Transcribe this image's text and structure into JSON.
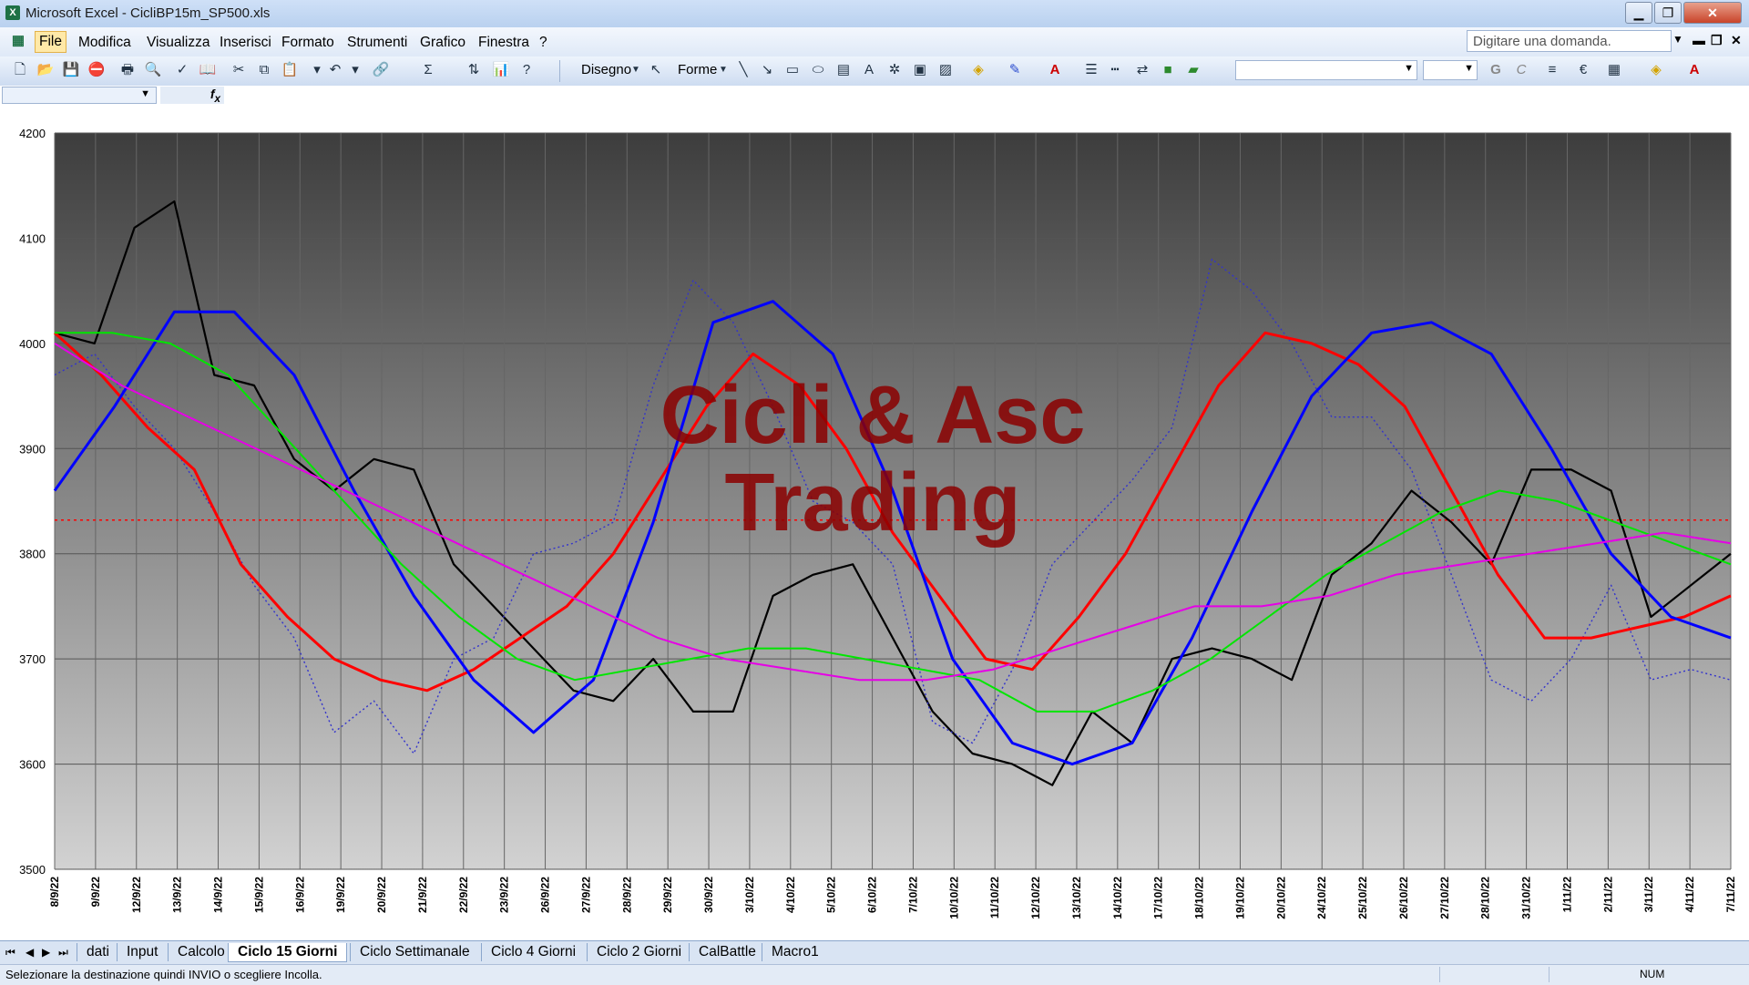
{
  "window": {
    "title": "Microsoft Excel - CicliBP15m_SP500.xls"
  },
  "menu": [
    "File",
    "Modifica",
    "Visualizza",
    "Inserisci",
    "Formato",
    "Strumenti",
    "Grafico",
    "Finestra",
    "?"
  ],
  "help_box": {
    "placeholder": "Digitare una domanda."
  },
  "toolbar": {
    "disegno_label": "Disegno",
    "forme_label": "Forme"
  },
  "sheets": [
    "dati",
    "Input",
    "Calcolo",
    "Ciclo 15 Giorni",
    "Ciclo Settimanale",
    "Ciclo 4 Giorni",
    "Ciclo 2 Giorni",
    "CalBattle",
    "Macro1"
  ],
  "active_sheet": "Ciclo 15 Giorni",
  "status": {
    "message": "Selezionare la destinazione quindi INVIO o scegliere Incolla.",
    "num": "NUM"
  },
  "watermark": {
    "line1": "Cicli & Asc",
    "line2": "Trading",
    "color": "#8b0000"
  },
  "chart_data": {
    "type": "line",
    "ylim": [
      3500,
      4200
    ],
    "y_ticks": [
      3500,
      3600,
      3700,
      3800,
      3900,
      4000,
      4100,
      4200
    ],
    "categories": [
      "8/9/22",
      "9/9/22",
      "12/9/22",
      "13/9/22",
      "14/9/22",
      "15/9/22",
      "16/9/22",
      "19/9/22",
      "20/9/22",
      "21/9/22",
      "22/9/22",
      "23/9/22",
      "26/9/22",
      "27/9/22",
      "28/9/22",
      "29/9/22",
      "30/9/22",
      "3/10/22",
      "4/10/22",
      "5/10/22",
      "6/10/22",
      "7/10/22",
      "10/10/22",
      "11/10/22",
      "12/10/22",
      "13/10/22",
      "14/10/22",
      "17/10/22",
      "18/10/22",
      "19/10/22",
      "20/10/22",
      "24/10/22",
      "25/10/22",
      "26/10/22",
      "27/10/22",
      "28/10/22",
      "31/10/22",
      "1/11/22",
      "2/11/22",
      "3/11/22",
      "4/11/22",
      "7/11/22"
    ],
    "reference_line": {
      "value": 3832,
      "color": "#ff0000",
      "style": "dotted"
    },
    "series": [
      {
        "color": "#000000",
        "width": 2.2,
        "style": "solid",
        "values": [
          4010,
          4000,
          4110,
          4135,
          3970,
          3960,
          3890,
          3860,
          3890,
          3880,
          3790,
          3750,
          3710,
          3670,
          3660,
          3700,
          3650,
          3650,
          3760,
          3780,
          3790,
          3720,
          3650,
          3610,
          3600,
          3580,
          3650,
          3620,
          3700,
          3710,
          3700,
          3680,
          3780,
          3810,
          3860,
          3830,
          3790,
          3880,
          3880,
          3860,
          3740,
          3770,
          3800
        ]
      },
      {
        "color": "#3333cc",
        "width": 1.4,
        "style": "dotted",
        "values": [
          3970,
          3990,
          3940,
          3900,
          3840,
          3770,
          3720,
          3630,
          3660,
          3610,
          3700,
          3720,
          3800,
          3810,
          3830,
          3960,
          4060,
          4020,
          3940,
          3850,
          3830,
          3790,
          3640,
          3620,
          3690,
          3790,
          3830,
          3870,
          3920,
          4080,
          4050,
          4000,
          3930,
          3930,
          3880,
          3780,
          3680,
          3660,
          3700,
          3770,
          3680,
          3690,
          3680
        ]
      },
      {
        "color": "#ff0000",
        "width": 3,
        "style": "solid",
        "values": [
          4010,
          3970,
          3920,
          3880,
          3790,
          3740,
          3700,
          3680,
          3670,
          3690,
          3720,
          3750,
          3800,
          3870,
          3940,
          3990,
          3960,
          3900,
          3820,
          3760,
          3700,
          3690,
          3740,
          3800,
          3880,
          3960,
          4010,
          4000,
          3980,
          3940,
          3860,
          3780,
          3720,
          3720,
          3730,
          3740,
          3760
        ]
      },
      {
        "color": "#0000ff",
        "width": 3,
        "style": "solid",
        "values": [
          3860,
          3940,
          4030,
          4030,
          3970,
          3860,
          3760,
          3680,
          3630,
          3680,
          3830,
          4020,
          4040,
          3990,
          3860,
          3700,
          3620,
          3600,
          3620,
          3720,
          3840,
          3950,
          4010,
          4020,
          3990,
          3900,
          3800,
          3740,
          3720
        ]
      },
      {
        "color": "#00e600",
        "width": 2,
        "style": "solid",
        "values": [
          4010,
          4010,
          4000,
          3970,
          3910,
          3850,
          3790,
          3740,
          3700,
          3680,
          3690,
          3700,
          3710,
          3710,
          3700,
          3690,
          3680,
          3650,
          3650,
          3670,
          3700,
          3740,
          3780,
          3810,
          3840,
          3860,
          3850,
          3830,
          3810,
          3790
        ]
      },
      {
        "color": "#e600e6",
        "width": 2,
        "style": "solid",
        "values": [
          4000,
          3960,
          3930,
          3900,
          3870,
          3840,
          3810,
          3780,
          3750,
          3720,
          3700,
          3690,
          3680,
          3680,
          3690,
          3710,
          3730,
          3750,
          3750,
          3760,
          3780,
          3790,
          3800,
          3810,
          3820,
          3810
        ]
      }
    ]
  }
}
